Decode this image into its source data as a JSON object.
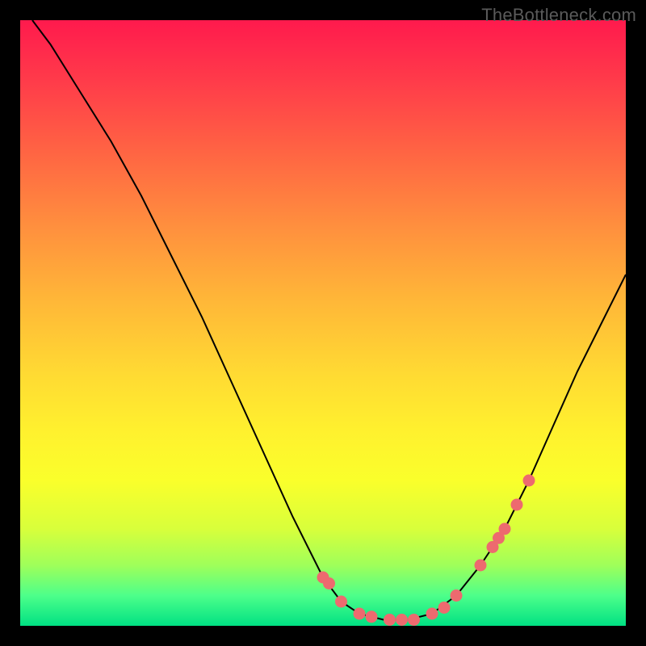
{
  "watermark": "TheBottleneck.com",
  "colors": {
    "page_bg": "#000000",
    "gradient_top": "#ff1a4d",
    "gradient_bottom": "#00e183",
    "curve": "#000000",
    "dot": "#ed6a6f"
  },
  "chart_data": {
    "type": "line",
    "title": "",
    "xlabel": "",
    "ylabel": "",
    "xlim": [
      0,
      1
    ],
    "ylim": [
      0,
      1
    ],
    "curve": {
      "x": [
        0.02,
        0.05,
        0.1,
        0.15,
        0.2,
        0.25,
        0.3,
        0.35,
        0.4,
        0.45,
        0.5,
        0.53,
        0.56,
        0.6,
        0.64,
        0.68,
        0.72,
        0.76,
        0.8,
        0.84,
        0.88,
        0.92,
        0.96,
        1.0
      ],
      "y": [
        1.0,
        0.96,
        0.88,
        0.8,
        0.71,
        0.61,
        0.51,
        0.4,
        0.29,
        0.18,
        0.08,
        0.04,
        0.02,
        0.01,
        0.01,
        0.02,
        0.05,
        0.1,
        0.16,
        0.24,
        0.33,
        0.42,
        0.5,
        0.58
      ]
    },
    "markers": {
      "x": [
        0.5,
        0.51,
        0.53,
        0.56,
        0.58,
        0.61,
        0.63,
        0.65,
        0.68,
        0.7,
        0.72,
        0.76,
        0.78,
        0.79,
        0.8,
        0.82,
        0.84
      ],
      "y": [
        0.08,
        0.07,
        0.04,
        0.02,
        0.015,
        0.01,
        0.01,
        0.01,
        0.02,
        0.03,
        0.05,
        0.1,
        0.13,
        0.145,
        0.16,
        0.2,
        0.24
      ]
    }
  }
}
